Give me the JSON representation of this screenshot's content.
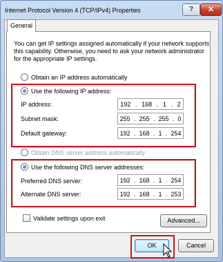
{
  "window": {
    "title": "Internet Protocol Version 4 (TCP/IPv4) Properties",
    "help_label": "?",
    "close_label": "✕"
  },
  "tabs": [
    {
      "label": "General",
      "selected": true
    }
  ],
  "description": "You can get IP settings assigned automatically if your network supports this capability. Otherwise, you need to ask your network administrator for the appropriate IP settings.",
  "ip_section": {
    "auto_option": {
      "label": "Obtain an IP address automatically",
      "checked": false
    },
    "manual_option": {
      "label": "Use the following IP address:",
      "checked": true
    },
    "fields": [
      {
        "label": "IP address:",
        "octets": [
          "192",
          "168",
          "1",
          "2"
        ]
      },
      {
        "label": "Subnet mask:",
        "octets": [
          "255",
          "255",
          "255",
          "0"
        ]
      },
      {
        "label": "Default gateway:",
        "octets": [
          "192",
          "168",
          "1",
          "254"
        ]
      }
    ]
  },
  "dns_section": {
    "auto_option": {
      "label": "Obtain DNS server address automatically",
      "checked": false,
      "disabled": true
    },
    "manual_option": {
      "label": "Use the following DNS server addresses:",
      "checked": true
    },
    "fields": [
      {
        "label": "Preferred DNS server:",
        "octets": [
          "192",
          "168",
          "1",
          "254"
        ]
      },
      {
        "label": "Alternate DNS server:",
        "octets": [
          "192",
          "168",
          "1",
          "253"
        ]
      }
    ]
  },
  "validate": {
    "label": "Validate settings upon exit",
    "checked": false
  },
  "buttons": {
    "advanced": "Advanced...",
    "ok": "OK",
    "cancel": "Cancel"
  },
  "colors": {
    "highlight": "#c8141e",
    "accent": "#1b5fbf"
  }
}
